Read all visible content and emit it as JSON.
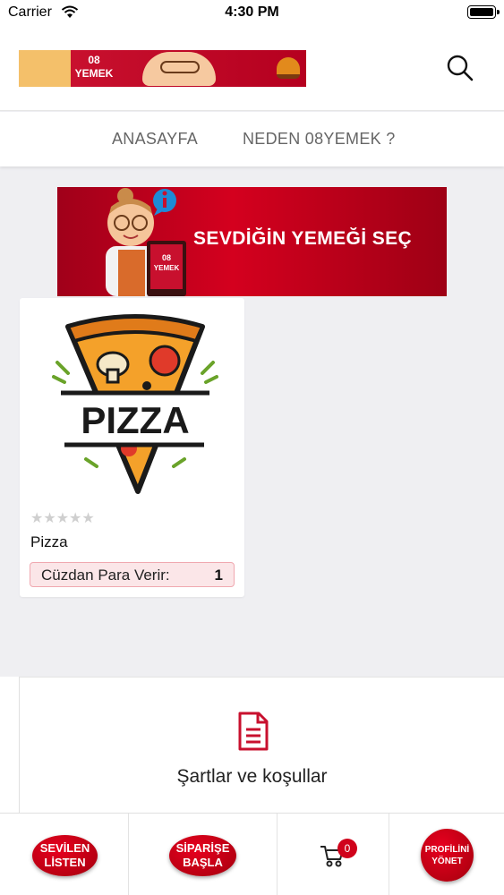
{
  "status_bar": {
    "carrier": "Carrier",
    "time": "4:30 PM"
  },
  "header": {
    "logo_text": "08\nYEMEK",
    "search_icon": "search-icon"
  },
  "nav": {
    "tabs": [
      "ANASAYFA",
      "NEDEN 08YEMEK ?"
    ]
  },
  "banner": {
    "text": "SEVDİĞİN YEMEĞİ SEÇ",
    "badge_text": "08\nYEMEK"
  },
  "products": [
    {
      "name": "Pizza",
      "image_text": "PIZZA",
      "rating": 0,
      "max_rating": 5,
      "wallet_label": "Cüzdan Para Verir:",
      "wallet_value": "1"
    }
  ],
  "terms": {
    "label": "Şartlar ve koşullar",
    "icon": "document-icon"
  },
  "tabbar": {
    "items": [
      {
        "label": "SEVİLEN\nLİSTEN"
      },
      {
        "label": "SİPARİŞE\nBAŞLA"
      },
      {
        "label": "",
        "icon": "cart-icon",
        "badge": "0"
      },
      {
        "label": "PROFİLİNİ\nYÖNET"
      }
    ]
  },
  "colors": {
    "brand_red": "#c8102e",
    "badge_red": "#d0021b",
    "background": "#efeff2"
  }
}
